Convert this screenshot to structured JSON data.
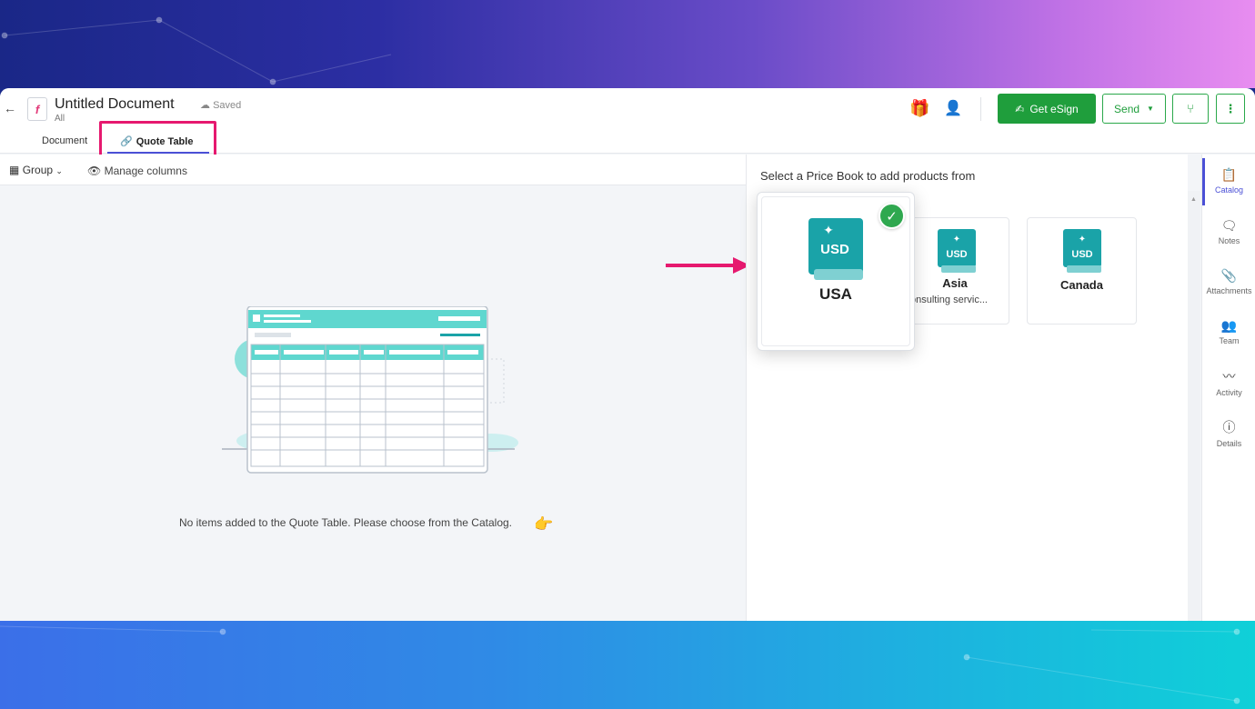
{
  "header": {
    "title": "Untitled Document",
    "subtitle": "All",
    "saved_status": "Saved",
    "tabs": [
      {
        "label": "Document"
      },
      {
        "label": "Quote Table"
      }
    ],
    "esign_label": "Get eSign",
    "send_label": "Send",
    "more_label": "⋮"
  },
  "toolbar": {
    "group_label": "Group",
    "manage_label": "Manage columns"
  },
  "main": {
    "empty_message": "No items added to the Quote Table. Please choose from the Catalog."
  },
  "catalog": {
    "title": "Select a Price Book to add products from",
    "books": [
      {
        "name": "USA",
        "currency": "USD",
        "selected": true
      },
      {
        "name": "Asia",
        "currency": "USD",
        "desc": "onsulting servic..."
      },
      {
        "name": "Canada",
        "currency": "USD"
      }
    ]
  },
  "rail": [
    {
      "label": "Catalog",
      "icon": "clipboard-icon"
    },
    {
      "label": "Notes",
      "icon": "notes-icon"
    },
    {
      "label": "Attachments",
      "icon": "paperclip-icon"
    },
    {
      "label": "Team",
      "icon": "team-icon"
    },
    {
      "label": "Activity",
      "icon": "activity-icon"
    },
    {
      "label": "Details",
      "icon": "info-icon"
    }
  ],
  "colors": {
    "accent": "#4b50d6",
    "esign_green": "#1f9e3c",
    "highlight_pink": "#e6196f",
    "book_teal": "#1aa3a8"
  }
}
